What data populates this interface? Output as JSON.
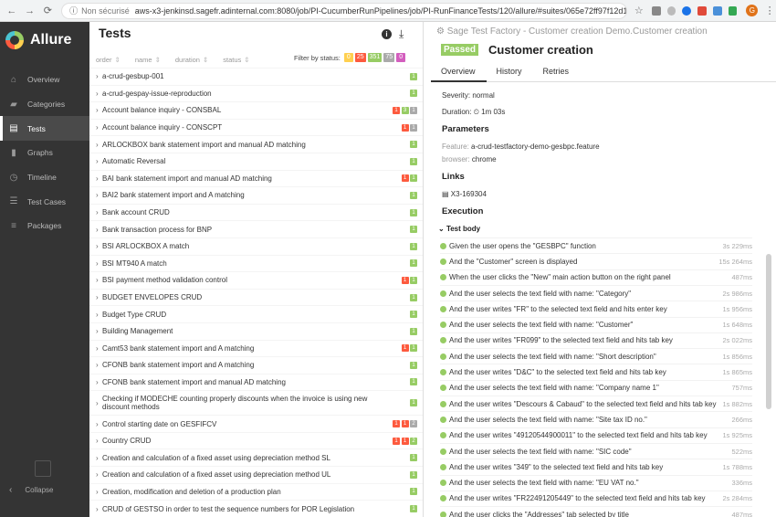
{
  "browser": {
    "security": "Non sécurisé",
    "url": "aws-x3-jenkinsd.sagefr.adinternal.com:8080/job/PI-CucumberRunPipelines/job/PI-RunFinanceTests/120/allure/#suites/065e72ff97f12d1c50529f361f588af7/6...",
    "avatar": "G"
  },
  "app": {
    "name": "Allure",
    "collapse": "Collapse"
  },
  "nav": [
    {
      "label": "Overview",
      "icon": "⌂"
    },
    {
      "label": "Categories",
      "icon": "▰"
    },
    {
      "label": "Tests",
      "icon": "▤"
    },
    {
      "label": "Graphs",
      "icon": "▮"
    },
    {
      "label": "Timeline",
      "icon": "◷"
    },
    {
      "label": "Test Cases",
      "icon": "☰"
    },
    {
      "label": "Packages",
      "icon": "≡"
    }
  ],
  "tests": {
    "title": "Tests",
    "sort": [
      "order",
      "name",
      "duration",
      "status"
    ],
    "filter_label": "Filter by status:",
    "filters": [
      "0",
      "25",
      "351",
      "75",
      "0"
    ],
    "rows": [
      {
        "name": "a-crud-gesbup-001",
        "badges": [
          [
            "1",
            "#97cc64"
          ]
        ]
      },
      {
        "name": "a-crud-gespay-issue-reproduction",
        "badges": [
          [
            "1",
            "#97cc64"
          ]
        ]
      },
      {
        "name": "Account balance inquiry - CONSBAL",
        "badges": [
          [
            "1",
            "#fd5a3e"
          ],
          [
            "3",
            "#97cc64"
          ],
          [
            "1",
            "#aaa"
          ]
        ]
      },
      {
        "name": "Account balance inquiry - CONSCPT",
        "badges": [
          [
            "1",
            "#fd5a3e"
          ],
          [
            "1",
            "#aaa"
          ]
        ]
      },
      {
        "name": "ARLOCKBOX bank statement import and manual AD matching",
        "badges": [
          [
            "1",
            "#97cc64"
          ]
        ]
      },
      {
        "name": "Automatic Reversal",
        "badges": [
          [
            "1",
            "#97cc64"
          ]
        ]
      },
      {
        "name": "BAI bank statement import and manual AD matching",
        "badges": [
          [
            "1",
            "#fd5a3e"
          ],
          [
            "1",
            "#97cc64"
          ]
        ]
      },
      {
        "name": "BAI2 bank statement import and A matching",
        "badges": [
          [
            "1",
            "#97cc64"
          ]
        ]
      },
      {
        "name": "Bank account CRUD",
        "badges": [
          [
            "1",
            "#97cc64"
          ]
        ]
      },
      {
        "name": "Bank transaction process for BNP",
        "badges": [
          [
            "1",
            "#97cc64"
          ]
        ]
      },
      {
        "name": "BSI ARLOCKBOX A match",
        "badges": [
          [
            "1",
            "#97cc64"
          ]
        ]
      },
      {
        "name": "BSI MT940 A match",
        "badges": [
          [
            "1",
            "#97cc64"
          ]
        ]
      },
      {
        "name": "BSI payment method validation control",
        "badges": [
          [
            "1",
            "#fd5a3e"
          ],
          [
            "1",
            "#97cc64"
          ]
        ]
      },
      {
        "name": "BUDGET ENVELOPES CRUD",
        "badges": [
          [
            "1",
            "#97cc64"
          ]
        ]
      },
      {
        "name": "Budget Type CRUD",
        "badges": [
          [
            "1",
            "#97cc64"
          ]
        ]
      },
      {
        "name": "Building Management",
        "badges": [
          [
            "1",
            "#97cc64"
          ]
        ]
      },
      {
        "name": "Camt53 bank statement import and A matching",
        "badges": [
          [
            "1",
            "#fd5a3e"
          ],
          [
            "1",
            "#97cc64"
          ]
        ]
      },
      {
        "name": "CFONB bank statement import and A matching",
        "badges": [
          [
            "1",
            "#97cc64"
          ]
        ]
      },
      {
        "name": "CFONB bank statement import and manual AD matching",
        "badges": [
          [
            "1",
            "#97cc64"
          ]
        ]
      },
      {
        "name": "Checking if MODECHE counting properly discounts when the invoice is using new discount methods",
        "badges": [
          [
            "1",
            "#97cc64"
          ]
        ],
        "tall": true
      },
      {
        "name": "Control starting date on GESFIFCV",
        "badges": [
          [
            "1",
            "#fd5a3e"
          ],
          [
            "1",
            "#fd5a3e"
          ],
          [
            "2",
            "#aaa"
          ]
        ]
      },
      {
        "name": "Country CRUD",
        "badges": [
          [
            "1",
            "#fd5a3e"
          ],
          [
            "1",
            "#fd5a3e"
          ],
          [
            "2",
            "#97cc64"
          ]
        ]
      },
      {
        "name": "Creation and calculation of a fixed asset using depreciation method SL",
        "badges": [
          [
            "1",
            "#97cc64"
          ]
        ]
      },
      {
        "name": "Creation and calculation of a fixed asset using depreciation method UL",
        "badges": [
          [
            "1",
            "#97cc64"
          ]
        ]
      },
      {
        "name": "Creation, modification and deletion of a production plan",
        "badges": [
          [
            "1",
            "#97cc64"
          ]
        ]
      },
      {
        "name": "CRUD of GESTSO in order to test the sequence numbers for POR Legislation",
        "badges": [
          [
            "1",
            "#97cc64"
          ]
        ]
      }
    ]
  },
  "detail": {
    "breadcrumb": "Sage Test Factory - Customer creation Demo.Customer creation",
    "status": "Passed",
    "title": "Customer creation",
    "tabs": [
      "Overview",
      "History",
      "Retries"
    ],
    "severity": "Severity: normal",
    "duration": "Duration: ⏲ 1m 03s",
    "parameters_title": "Parameters",
    "params": [
      {
        "k": "Feature: ",
        "v": "a-crud-testfactory-demo-gesbpc.feature"
      },
      {
        "k": "browser: ",
        "v": "chrome"
      }
    ],
    "links_title": "Links",
    "link": "X3-169304",
    "execution_title": "Execution",
    "test_body": "Test body",
    "steps": [
      {
        "t": "Given the user opens the \"GESBPC\" function",
        "d": "3s 229ms"
      },
      {
        "t": "And the \"Customer\" screen is displayed",
        "d": "15s 264ms"
      },
      {
        "t": "When the user clicks the \"New\" main action button on the right panel",
        "d": "487ms"
      },
      {
        "t": "And the user selects the text field with name: \"Category\"",
        "d": "2s 986ms"
      },
      {
        "t": "And the user writes \"FR\" to the selected text field and hits enter key",
        "d": "1s 956ms"
      },
      {
        "t": "And the user selects the text field with name: \"Customer\"",
        "d": "1s 648ms"
      },
      {
        "t": "And the user writes \"FR099\" to the selected text field and hits tab key",
        "d": "2s 022ms"
      },
      {
        "t": "And the user selects the text field with name: \"Short description\"",
        "d": "1s 856ms"
      },
      {
        "t": "And the user writes \"D&C\" to the selected text field and hits tab key",
        "d": "1s 865ms"
      },
      {
        "t": "And the user selects the text field with name: \"Company name 1\"",
        "d": "757ms"
      },
      {
        "t": "And the user writes \"Descours & Cabaud\" to the selected text field and hits tab key",
        "d": "1s 882ms"
      },
      {
        "t": "And the user selects the text field with name: \"Site tax ID no.\"",
        "d": "266ms"
      },
      {
        "t": "And the user writes \"49120544900011\" to the selected text field and hits tab key",
        "d": "1s 925ms"
      },
      {
        "t": "And the user selects the text field with name: \"SIC code\"",
        "d": "522ms"
      },
      {
        "t": "And the user writes \"349\" to the selected text field and hits tab key",
        "d": "1s 788ms"
      },
      {
        "t": "And the user selects the text field with name: \"EU VAT no.\"",
        "d": "336ms"
      },
      {
        "t": "And the user writes \"FR22491205449\" to the selected text field and hits tab key",
        "d": "2s 284ms"
      },
      {
        "t": "And the user clicks the \"Addresses\" tab selected by title",
        "d": "487ms"
      }
    ]
  },
  "colors": {
    "passed": "#97cc64",
    "failed": "#fd5a3e",
    "broken": "#ffd050",
    "skipped": "#aaaaaa",
    "unknown": "#d35ebe"
  }
}
